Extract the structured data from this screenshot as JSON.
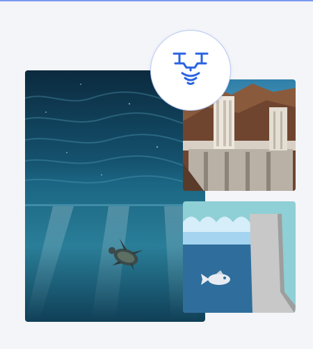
{
  "colors": {
    "background": "#f4f5f8",
    "top_rule": "#7a97ef",
    "accent_blue": "#2a63e0",
    "water_dark": "#0c3147",
    "water_mid": "#1d6a86",
    "water_light": "#3f97af",
    "cartoon_sky": "#8fcfd6",
    "cartoon_water": "#2f6e9c",
    "cartoon_wave": "#a4d4f0",
    "cartoon_wall": "#c8c8c8",
    "cartoon_fish": "#e8ecf2"
  },
  "images": {
    "underwater_photo": {
      "icon": "ocean-turtle-photo"
    },
    "dam_photo": {
      "icon": "hoover-dam-photo"
    },
    "dam_illustration": {
      "icon": "dam-fish-illustration"
    }
  },
  "badge": {
    "icon": "drone-sonar-icon"
  }
}
